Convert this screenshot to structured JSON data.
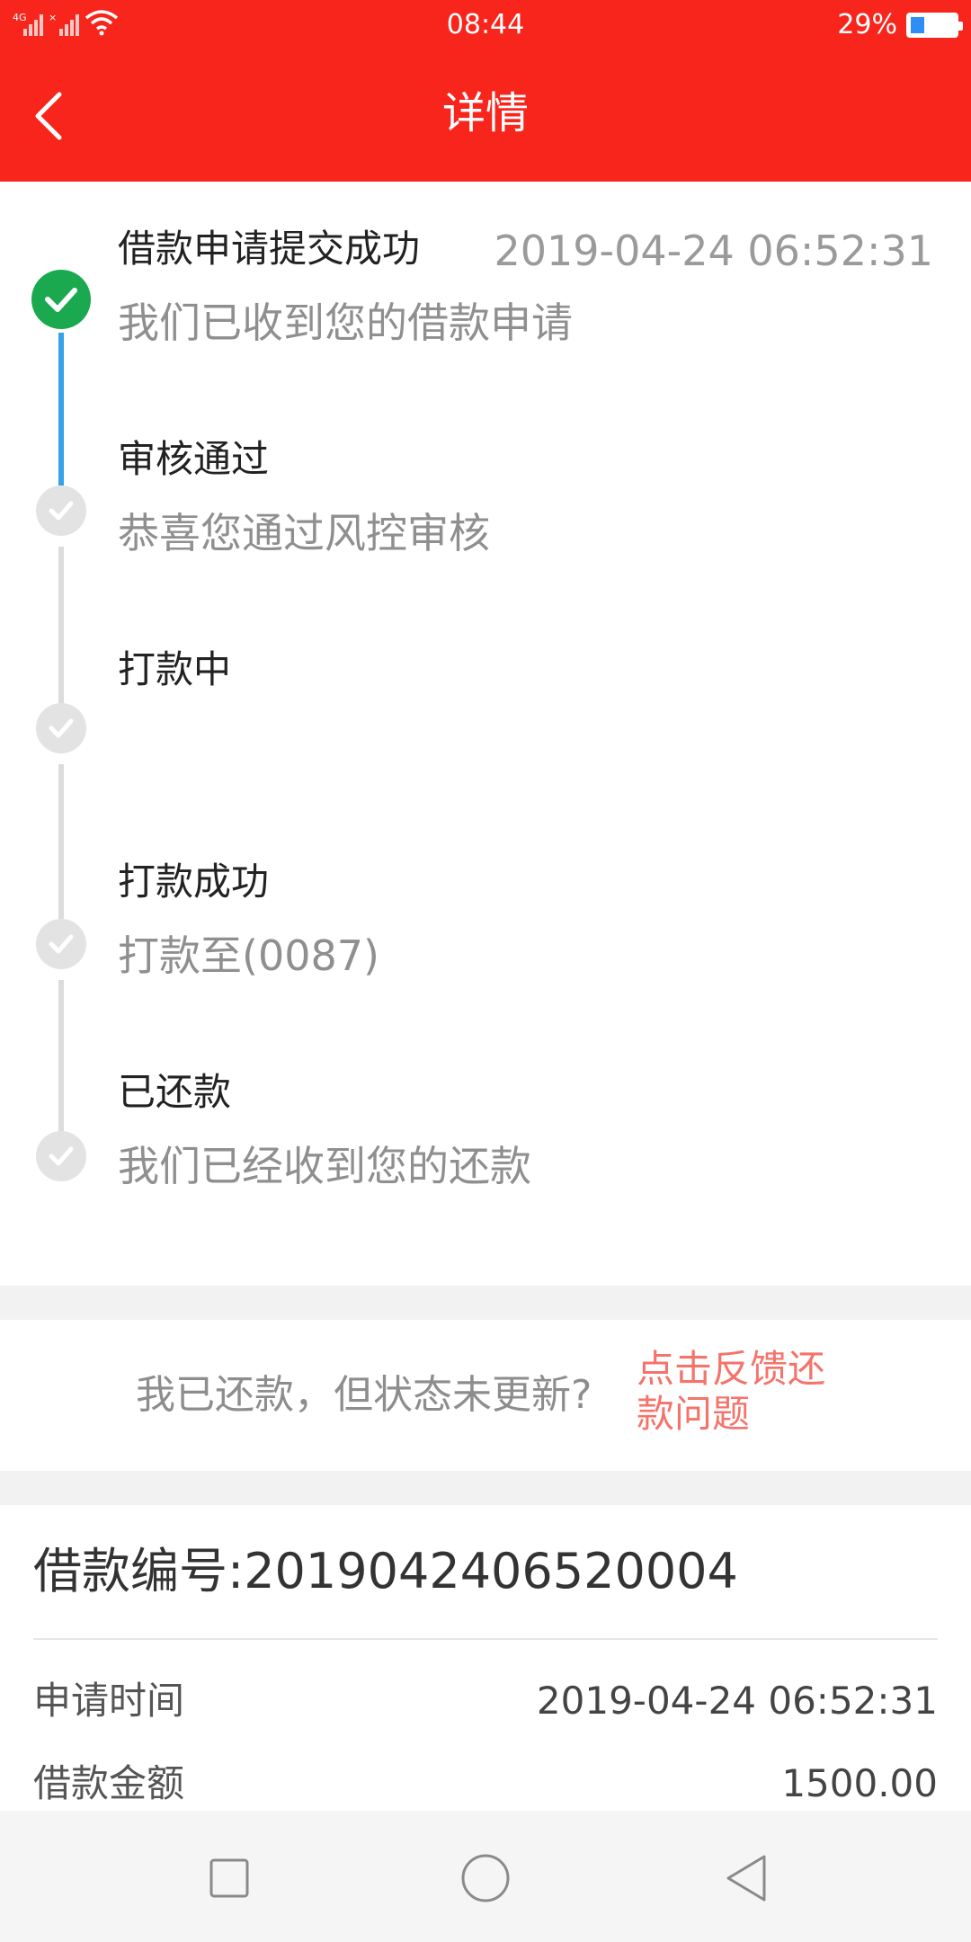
{
  "status_bar": {
    "network_tag": "4G",
    "time": "08:44",
    "battery_percent_text": "29%",
    "battery_level": 0.29
  },
  "header": {
    "title": "详情",
    "back_icon": "chevron-left-icon",
    "background_color": "#f8251c"
  },
  "timeline": {
    "steps": [
      {
        "title": "借款申请提交成功",
        "time": "2019-04-24 06:52:31",
        "desc": "我们已收到您的借款申请",
        "status": "done"
      },
      {
        "title": "审核通过",
        "time": "",
        "desc": "恭喜您通过风控审核",
        "status": "pending"
      },
      {
        "title": "打款中",
        "time": "",
        "desc": "",
        "status": "pending"
      },
      {
        "title": "打款成功",
        "time": "",
        "desc": "打款至(0087)",
        "status": "pending"
      },
      {
        "title": "已还款",
        "time": "",
        "desc": "我们已经收到您的还款",
        "status": "pending"
      }
    ],
    "done_color": "#1aa94e",
    "progress_line_color": "#36a2e8",
    "pending_color": "#e3e3e3"
  },
  "feedback": {
    "question": "我已还款，但状态未更新?",
    "link_text": "点击反馈还款问题",
    "link_color": "#f4746b"
  },
  "loan_info": {
    "loan_number_label": "借款编号:2019042406520004",
    "rows": [
      {
        "label": "申请时间",
        "value": "2019-04-24 06:52:31"
      },
      {
        "label": "借款金额",
        "value": "1500.00"
      }
    ]
  },
  "nav_bar": {
    "recent_icon": "square-icon",
    "home_icon": "circle-icon",
    "back_icon": "triangle-back-icon"
  }
}
